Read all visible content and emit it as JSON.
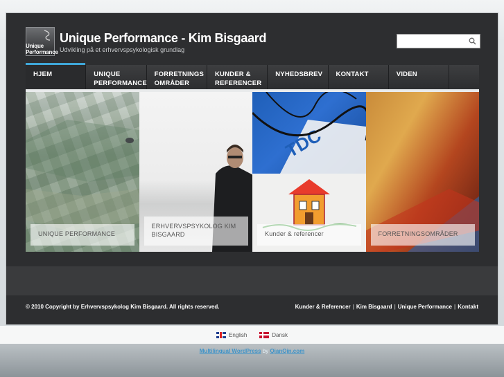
{
  "header": {
    "logo_text_line1": "Unique",
    "logo_text_line2": "Performance",
    "title": "Unique Performance - Kim Bisgaard",
    "subtitle": "Udvikling på et erhvervspsykologisk grundlag",
    "search_placeholder": "",
    "search_value": ""
  },
  "nav": {
    "items": [
      {
        "label": "HJEM",
        "active": true
      },
      {
        "label": "UNIQUE\nPERFORMANCE",
        "active": false
      },
      {
        "label": "FORRETNINGS\nOMRÅDER",
        "active": false
      },
      {
        "label": "KUNDER &\nREFERENCER",
        "active": false
      },
      {
        "label": "NYHEDSBREV",
        "active": false
      },
      {
        "label": "KONTAKT",
        "active": false
      },
      {
        "label": "VIDEN",
        "active": false
      }
    ]
  },
  "panels": [
    {
      "label": "UNIQUE PERFORMANCE",
      "image": "aerial-landscape"
    },
    {
      "label": "ERHVERVSPSYKOLOG KIM BISGAARD",
      "image": "portrait-man"
    },
    {
      "label": "Kunder & referencer",
      "image": "tdc-cable-and-house-drawing"
    },
    {
      "label": "FORRETNINGSOMRÅDER",
      "image": "book-covers"
    }
  ],
  "footer": {
    "copyright": "© 2010 Copyright by Erhvervspsykolog Kim Bisgaard. All rights reserved.",
    "links": [
      "Kunder & Referencer",
      "Kim Bisgaard",
      "Unique Performance",
      "Kontakt"
    ]
  },
  "languages": [
    {
      "label": "English",
      "flag": "uk-flag-icon"
    },
    {
      "label": "Dansk",
      "flag": "denmark-flag-icon"
    }
  ],
  "powered": {
    "link1": "Multilingual WordPress",
    "by": "by",
    "link2": "QianQin.com"
  },
  "colors": {
    "accent": "#3fa6d8",
    "background": "#2d2e30",
    "link": "#3e93c8"
  }
}
